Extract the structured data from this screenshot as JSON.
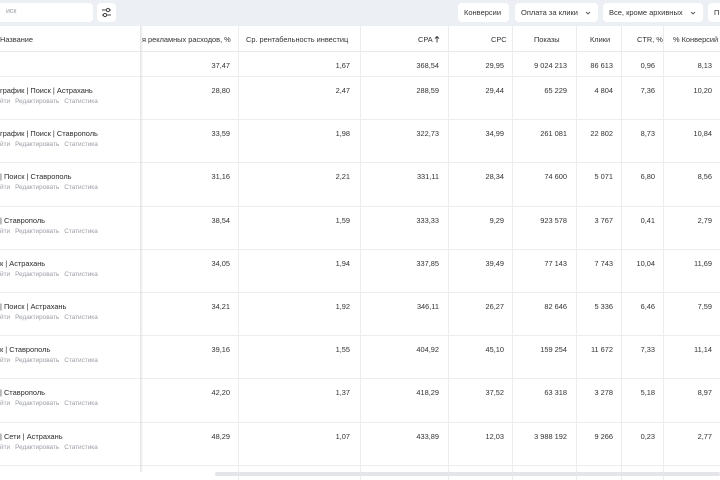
{
  "toolbar": {
    "search_placeholder": "иск",
    "conversions_label": "Конверсии",
    "payment_label": "Оплата за клики",
    "status_label": "Все, кроме архивных",
    "extra_label": "П"
  },
  "columns": [
    "Название",
    "я рекламных расходов, %",
    "Ср. рентабельность инвестиц",
    "CPA",
    "CPC",
    "Показы",
    "Клики",
    "CTR, %",
    "% Конверсий"
  ],
  "row_links": [
    "йти",
    "Редактировать",
    "Статистика"
  ],
  "totals": [
    "37,47",
    "1,67",
    "368,54",
    "29,95",
    "9 024 213",
    "86 613",
    "0,96",
    "8,13"
  ],
  "rows": [
    {
      "name": "график | Поиск | Астрахань",
      "values": [
        "28,80",
        "2,47",
        "288,59",
        "29,44",
        "65 229",
        "4 804",
        "7,36",
        "10,20"
      ]
    },
    {
      "name": "график | Поиск | Ставрополь",
      "values": [
        "33,59",
        "1,98",
        "322,73",
        "34,99",
        "261 081",
        "22 802",
        "8,73",
        "10,84"
      ]
    },
    {
      "name": "| Поиск | Ставрополь",
      "values": [
        "31,16",
        "2,21",
        "331,11",
        "28,34",
        "74 600",
        "5 071",
        "6,80",
        "8,56"
      ]
    },
    {
      "name": "| Ставрополь",
      "values": [
        "38,54",
        "1,59",
        "333,33",
        "9,29",
        "923 578",
        "3 767",
        "0,41",
        "2,79"
      ]
    },
    {
      "name": "к | Астрахань",
      "values": [
        "34,05",
        "1,94",
        "337,85",
        "39,49",
        "77 143",
        "7 743",
        "10,04",
        "11,69"
      ]
    },
    {
      "name": "| Поиск | Астрахань",
      "values": [
        "34,21",
        "1,92",
        "346,11",
        "26,27",
        "82 646",
        "5 336",
        "6,46",
        "7,59"
      ]
    },
    {
      "name": "к | Ставрополь",
      "values": [
        "39,16",
        "1,55",
        "404,92",
        "45,10",
        "159 254",
        "11 672",
        "7,33",
        "11,14"
      ]
    },
    {
      "name": "| Ставрополь",
      "values": [
        "42,20",
        "1,37",
        "418,29",
        "37,52",
        "63 318",
        "3 278",
        "5,18",
        "8,97"
      ]
    },
    {
      "name": "| Сети | Астрахань",
      "values": [
        "48,29",
        "1,07",
        "433,89",
        "12,03",
        "3 988 192",
        "9 266",
        "0,23",
        "2,77"
      ]
    }
  ]
}
